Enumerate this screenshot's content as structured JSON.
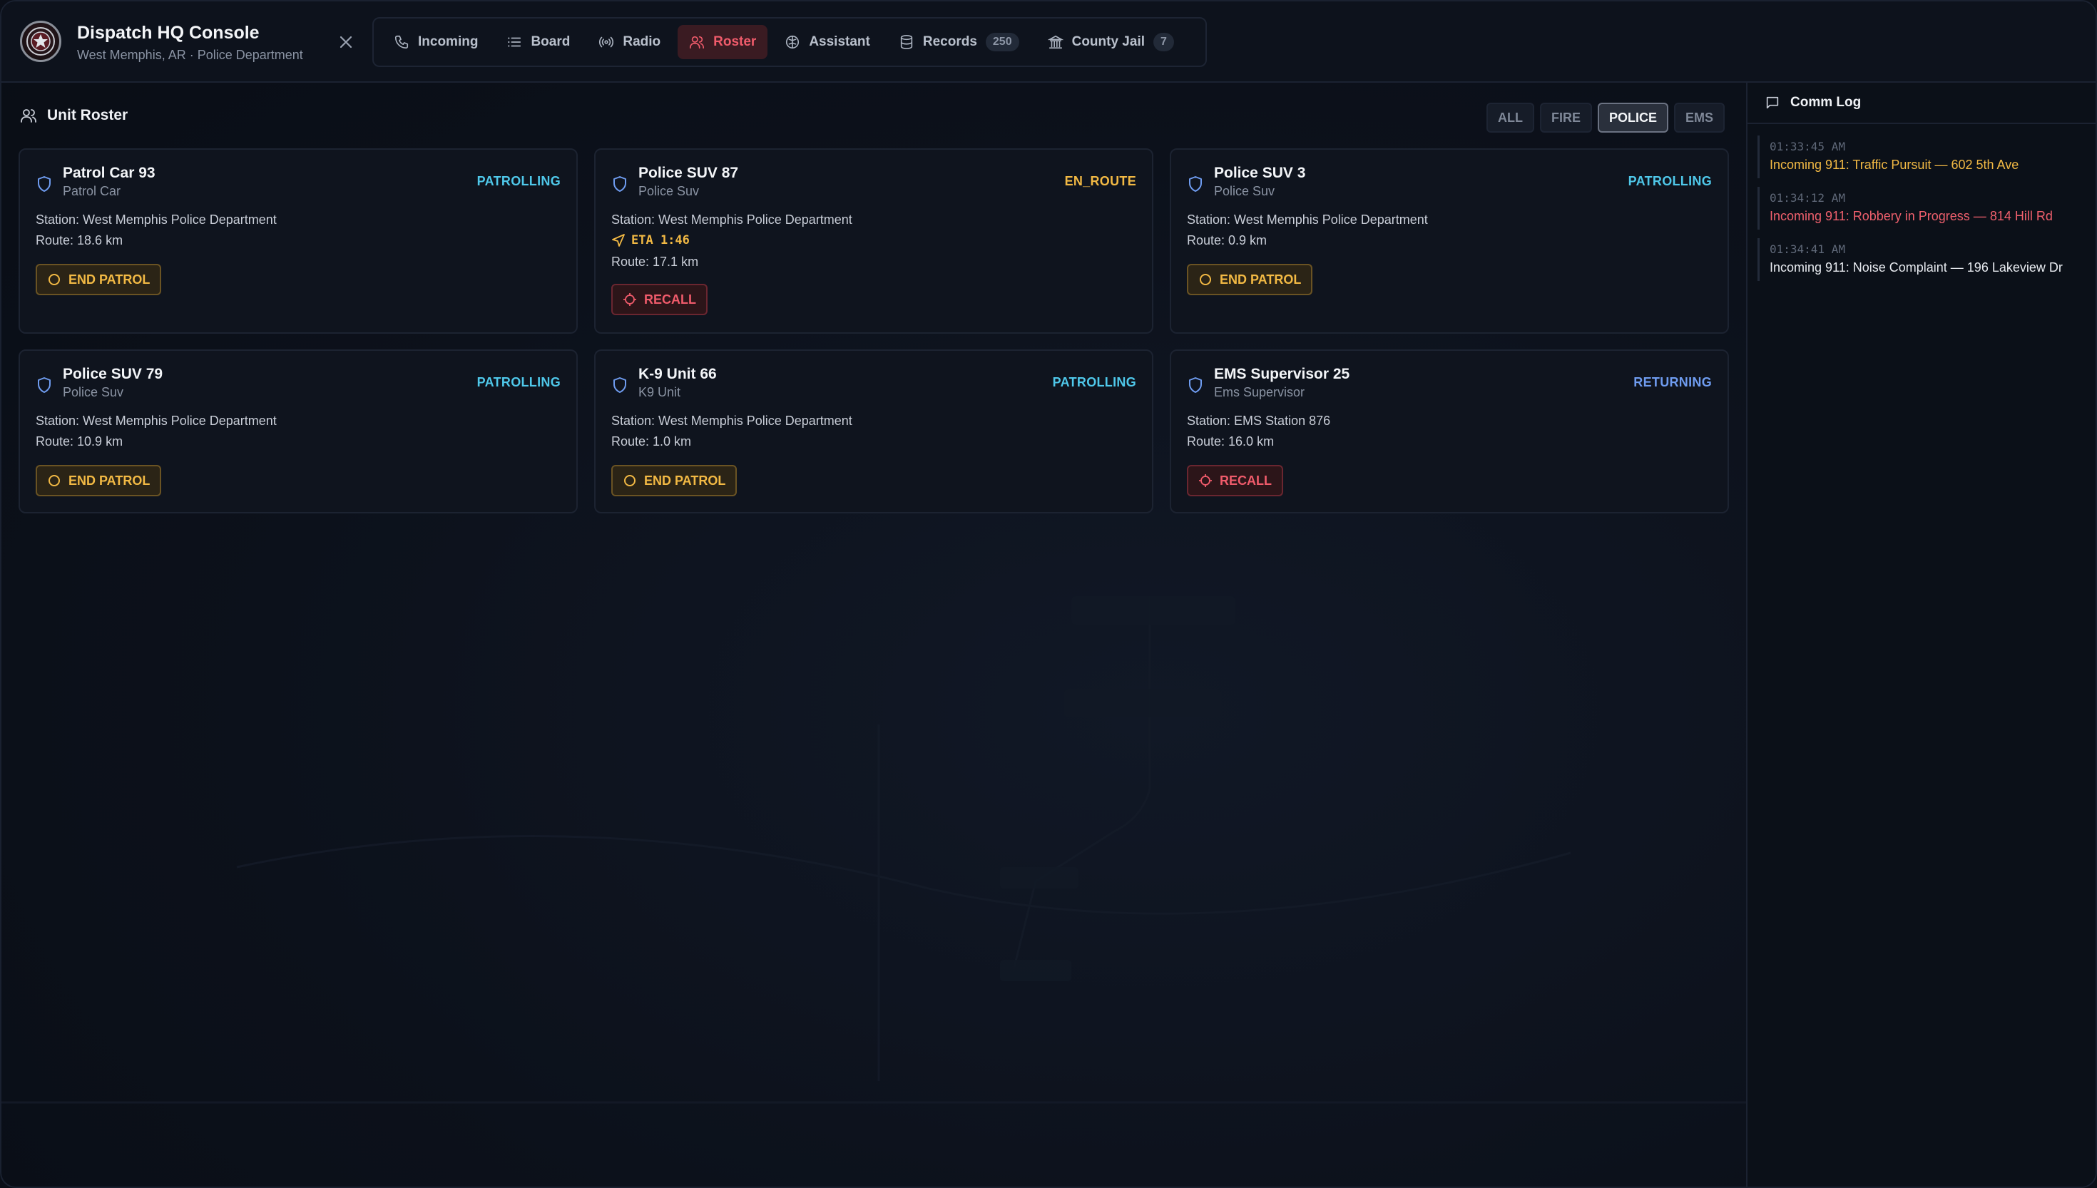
{
  "header": {
    "title": "Dispatch HQ Console",
    "subtitle": "West Memphis, AR · Police Department",
    "logo_icon": "dispatch-badge-icon"
  },
  "nav": {
    "tabs": [
      {
        "label": "Incoming",
        "icon": "phone-icon",
        "active": false
      },
      {
        "label": "Board",
        "icon": "list-icon",
        "active": false
      },
      {
        "label": "Radio",
        "icon": "radio-icon",
        "active": false
      },
      {
        "label": "Roster",
        "icon": "users-icon",
        "active": true
      },
      {
        "label": "Assistant",
        "icon": "brain-icon",
        "active": false
      },
      {
        "label": "Records",
        "icon": "database-icon",
        "active": false,
        "badge": "250"
      },
      {
        "label": "County Jail",
        "icon": "building-icon",
        "active": false,
        "badge": "7"
      }
    ]
  },
  "roster": {
    "title": "Unit Roster",
    "filters": [
      {
        "label": "ALL",
        "active": false
      },
      {
        "label": "FIRE",
        "active": false
      },
      {
        "label": "POLICE",
        "active": true
      },
      {
        "label": "EMS",
        "active": false
      }
    ],
    "units": [
      {
        "name": "Patrol Car 93",
        "type": "Patrol Car",
        "status": "PATROLLING",
        "station": "Station: West Memphis Police Department",
        "eta": "",
        "route": "Route: 18.6 km",
        "action": "END PATROL"
      },
      {
        "name": "Police SUV 87",
        "type": "Police Suv",
        "status": "EN_ROUTE",
        "station": "Station: West Memphis Police Department",
        "eta": "ETA 1:46",
        "route": "Route: 17.1 km",
        "action": "RECALL"
      },
      {
        "name": "Police SUV 3",
        "type": "Police Suv",
        "status": "PATROLLING",
        "station": "Station: West Memphis Police Department",
        "eta": "",
        "route": "Route: 0.9 km",
        "action": "END PATROL"
      },
      {
        "name": "Police SUV 79",
        "type": "Police Suv",
        "status": "PATROLLING",
        "station": "Station: West Memphis Police Department",
        "eta": "",
        "route": "Route: 10.9 km",
        "action": "END PATROL"
      },
      {
        "name": "K-9 Unit 66",
        "type": "K9 Unit",
        "status": "PATROLLING",
        "station": "Station: West Memphis Police Department",
        "eta": "",
        "route": "Route: 1.0 km",
        "action": "END PATROL"
      },
      {
        "name": "EMS Supervisor 25",
        "type": "Ems Supervisor",
        "status": "RETURNING",
        "station": "Station: EMS Station 876",
        "eta": "",
        "route": "Route: 16.0 km",
        "action": "RECALL"
      }
    ]
  },
  "commlog": {
    "title": "Comm Log",
    "entries": [
      {
        "time": "01:33:45 AM",
        "message": "Incoming 911: Traffic Pursuit — 602 5th Ave",
        "color": "#f2b944"
      },
      {
        "time": "01:34:12 AM",
        "message": "Incoming 911: Robbery in Progress — 814 Hill Rd",
        "color": "#f0606d"
      },
      {
        "time": "01:34:41 AM",
        "message": "Incoming 911: Noise Complaint — 196 Lakeview Dr",
        "color": "#e8ebf0"
      }
    ]
  },
  "colors": {
    "patrolling": "#4fc8ea",
    "en_route": "#f2b944",
    "returning": "#6f9cf0",
    "accent_red": "#f05b6b",
    "shield": "#6f9cf0"
  }
}
